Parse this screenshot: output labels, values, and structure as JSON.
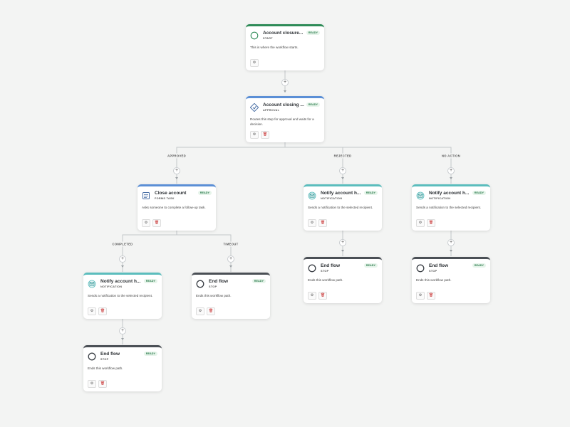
{
  "nodes": {
    "start": {
      "title": "Account closure...",
      "type": "START",
      "badge": "READY",
      "desc": "This is where the workflow starts.",
      "icon": "circle-icon"
    },
    "approval": {
      "title": "Account closing ...",
      "type": "APPROVAL",
      "badge": "READY",
      "desc": "Routes this step for approval and waits for a decision.",
      "icon": "approval-icon"
    },
    "close_account": {
      "title": "Close account",
      "type": "FORMS TASK",
      "badge": "READY",
      "desc": "Asks someone to complete a follow-up task.",
      "icon": "form-icon"
    },
    "notify_1": {
      "title": "Notify account h...",
      "type": "NOTIFICATION",
      "badge": "READY",
      "desc": "Sends a notification to the selected recipient.",
      "icon": "notification-icon"
    },
    "notify_2": {
      "title": "Notify account h...",
      "type": "NOTIFICATION",
      "badge": "READY",
      "desc": "Sends a notification to the selected recipient.",
      "icon": "notification-icon"
    },
    "notify_3": {
      "title": "Notify account h...",
      "type": "NOTIFICATION",
      "badge": "READY",
      "desc": "Sends a notification to the selected recipient.",
      "icon": "notification-icon"
    },
    "end_1": {
      "title": "End flow",
      "type": "STOP",
      "badge": "READY",
      "desc": "Ends this workflow path.",
      "icon": "stop-icon"
    },
    "end_2": {
      "title": "End flow",
      "type": "STOP",
      "badge": "READY",
      "desc": "Ends this workflow path.",
      "icon": "stop-icon"
    },
    "end_3": {
      "title": "End flow",
      "type": "STOP",
      "badge": "READY",
      "desc": "Ends this workflow path.",
      "icon": "stop-icon"
    },
    "end_4": {
      "title": "End flow",
      "type": "STOP",
      "badge": "READY",
      "desc": "Ends this workflow path.",
      "icon": "stop-icon"
    }
  },
  "branches": {
    "approved": "APPROVED",
    "rejected": "REJECTED",
    "no_action": "NO ACTION",
    "completed": "COMPLETED",
    "timeout": "TIMEOUT"
  },
  "actions": {
    "settings": "⚙",
    "delete": "🗑"
  },
  "colors": {
    "start": "#2e8b57",
    "approval": "#5b8fd6",
    "notification": "#5bbdbd",
    "stop": "#4a4f55",
    "badge": "#2e7d4f"
  }
}
